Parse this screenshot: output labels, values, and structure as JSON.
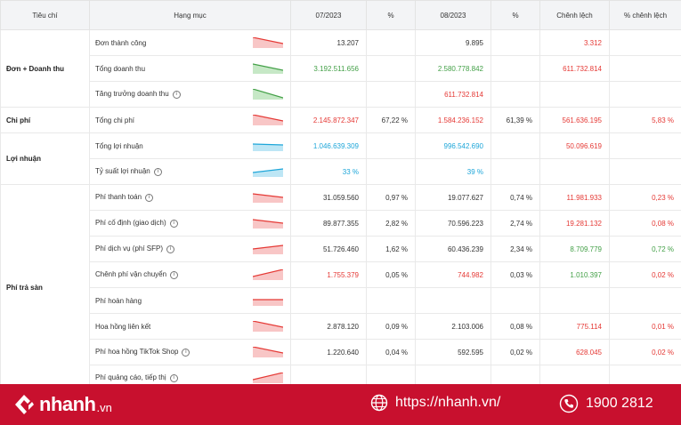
{
  "columns": [
    "Tiêu chí",
    "Hạng mục",
    "07/2023",
    "%",
    "08/2023",
    "%",
    "Chênh lệch",
    "% chênh lệch"
  ],
  "groups": [
    {
      "name": "Đơn + Doanh thu",
      "rowspan": 3
    },
    {
      "name": "Chi phí",
      "rowspan": 1
    },
    {
      "name": "Lợi nhuận",
      "rowspan": 2
    },
    {
      "name": "Phí trả sàn",
      "rowspan": 8
    }
  ],
  "rows": [
    {
      "label": "Đơn thành công",
      "info": false,
      "spark": "down-red",
      "m07": "13.207",
      "m07_color": "dark",
      "p07": "",
      "m08": "9.895",
      "m08_color": "dark",
      "p08": "",
      "diff": "3.312",
      "diff_color": "red",
      "pdiff": "",
      "pdiff_color": "red"
    },
    {
      "label": "Tổng doanh thu",
      "info": false,
      "spark": "down-green",
      "m07": "3.192.511.656",
      "m07_color": "green",
      "p07": "",
      "m08": "2.580.778.842",
      "m08_color": "green",
      "p08": "",
      "diff": "611.732.814",
      "diff_color": "red",
      "pdiff": "",
      "pdiff_color": "red"
    },
    {
      "label": "Tăng trưởng doanh thu",
      "info": true,
      "spark": "steep-green",
      "m07": "",
      "m07_color": "dark",
      "p07": "",
      "m08": "611.732.814",
      "m08_color": "red",
      "p08": "",
      "diff": "",
      "diff_color": "red",
      "pdiff": "",
      "pdiff_color": "red"
    },
    {
      "label": "Tổng chi phí",
      "info": false,
      "spark": "down-red",
      "m07": "2.145.872.347",
      "m07_color": "red",
      "p07": "67,22 %",
      "m08": "1.584.236.152",
      "m08_color": "red",
      "p08": "61,39 %",
      "diff": "561.636.195",
      "diff_color": "red",
      "pdiff": "5,83 %",
      "pdiff_color": "red"
    },
    {
      "label": "Tổng lợi nhuận",
      "info": false,
      "spark": "flat-blue",
      "m07": "1.046.639.309",
      "m07_color": "blue",
      "p07": "",
      "m08": "996.542.690",
      "m08_color": "blue",
      "p08": "",
      "diff": "50.096.619",
      "diff_color": "red",
      "pdiff": "",
      "pdiff_color": "red"
    },
    {
      "label": "Tỷ suất lợi nhuận",
      "info": true,
      "spark": "up-blue",
      "m07": "33 %",
      "m07_color": "blue",
      "p07": "",
      "m08": "39 %",
      "m08_color": "blue",
      "p08": "",
      "diff": "",
      "diff_color": "red",
      "pdiff": "",
      "pdiff_color": "red"
    },
    {
      "label": "Phí thanh toán",
      "info": true,
      "spark": "slight-down-red",
      "m07": "31.059.560",
      "m07_color": "dark",
      "p07": "0,97 %",
      "m08": "19.077.627",
      "m08_color": "dark",
      "p08": "0,74 %",
      "diff": "11.981.933",
      "diff_color": "red",
      "pdiff": "0,23 %",
      "pdiff_color": "red"
    },
    {
      "label": "Phí cố định (giao dịch)",
      "info": true,
      "spark": "slight-down-red",
      "m07": "89.877.355",
      "m07_color": "dark",
      "p07": "2,82 %",
      "m08": "70.596.223",
      "m08_color": "dark",
      "p08": "2,74 %",
      "diff": "19.281.132",
      "diff_color": "red",
      "pdiff": "0,08 %",
      "pdiff_color": "red"
    },
    {
      "label": "Phí dịch vụ (phí SFP)",
      "info": true,
      "spark": "slight-up-red",
      "m07": "51.726.460",
      "m07_color": "dark",
      "p07": "1,62 %",
      "m08": "60.436.239",
      "m08_color": "dark",
      "p08": "2,34 %",
      "diff": "8.709.779",
      "diff_color": "green",
      "pdiff": "0,72 %",
      "pdiff_color": "green"
    },
    {
      "label": "Chênh phí vận chuyển",
      "info": true,
      "spark": "up-red",
      "m07": "1.755.379",
      "m07_color": "red",
      "p07": "0,05 %",
      "m08": "744.982",
      "m08_color": "red",
      "p08": "0,03 %",
      "diff": "1.010.397",
      "diff_color": "green",
      "pdiff": "0,02 %",
      "pdiff_color": "red"
    },
    {
      "label": "Phí hoàn hàng",
      "info": false,
      "spark": "flat-red",
      "m07": "",
      "m07_color": "dark",
      "p07": "",
      "m08": "",
      "m08_color": "dark",
      "p08": "",
      "diff": "",
      "diff_color": "red",
      "pdiff": "",
      "pdiff_color": "red"
    },
    {
      "label": "Hoa hồng liên kết",
      "info": false,
      "spark": "down-red",
      "m07": "2.878.120",
      "m07_color": "dark",
      "p07": "0,09 %",
      "m08": "2.103.006",
      "m08_color": "dark",
      "p08": "0,08 %",
      "diff": "775.114",
      "diff_color": "red",
      "pdiff": "0,01 %",
      "pdiff_color": "red"
    },
    {
      "label": "Phí hoa hồng TikTok Shop",
      "info": true,
      "spark": "down-red",
      "m07": "1.220.640",
      "m07_color": "dark",
      "p07": "0,04 %",
      "m08": "592.595",
      "m08_color": "dark",
      "p08": "0,02 %",
      "diff": "628.045",
      "diff_color": "red",
      "pdiff": "0,02 %",
      "pdiff_color": "red"
    },
    {
      "label": "Phí quảng cáo, tiếp thị",
      "info": true,
      "spark": "up-red",
      "m07": "",
      "m07_color": "dark",
      "p07": "",
      "m08": "",
      "m08_color": "dark",
      "p08": "",
      "diff": "",
      "diff_color": "red",
      "pdiff": "",
      "pdiff_color": "red"
    }
  ],
  "colors": {
    "red": "#e53935",
    "green": "#43a047",
    "blue": "#1ea6d9",
    "dark": "#333333",
    "brand": "#c8102e"
  },
  "footer": {
    "logo_name": "nhanh",
    "logo_tld": ".vn",
    "website": "https://nhanh.vn/",
    "phone": "1900 2812"
  }
}
